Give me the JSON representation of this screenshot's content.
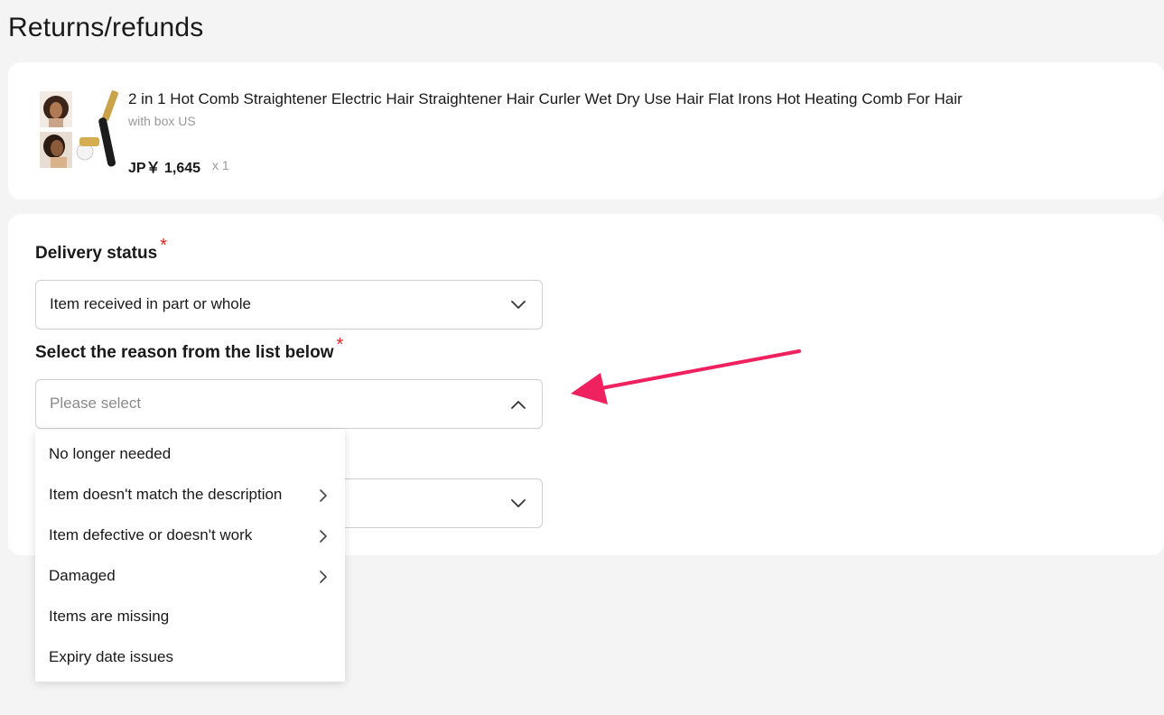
{
  "page": {
    "title": "Returns/refunds"
  },
  "product": {
    "title": "2 in 1 Hot Comb Straightener Electric Hair Straightener Hair Curler Wet Dry Use Hair Flat Irons Hot Heating Comb For Hair",
    "variant": "with box US",
    "price": "JP￥ 1,645",
    "quantity": "x 1"
  },
  "form": {
    "delivery_status": {
      "label": "Delivery status",
      "required_mark": "*",
      "value": "Item received in part or whole",
      "icon": "chevron-down-icon"
    },
    "reason": {
      "label": "Select the reason from the list below",
      "required_mark": "*",
      "placeholder": "Please select",
      "icon": "chevron-up-icon",
      "options": [
        {
          "label": "No longer needed",
          "has_submenu": false
        },
        {
          "label": "Item doesn't match the description",
          "has_submenu": true
        },
        {
          "label": "Item defective or doesn't work",
          "has_submenu": true
        },
        {
          "label": "Damaged",
          "has_submenu": true
        },
        {
          "label": "Items are missing",
          "has_submenu": false
        },
        {
          "label": "Expiry date issues",
          "has_submenu": false
        }
      ]
    },
    "third_select": {
      "icon": "chevron-down-icon"
    }
  },
  "colors": {
    "required": "#e0211d",
    "annotation_arrow": "#f0215f",
    "background": "#f4f4f4",
    "card": "#ffffff"
  }
}
